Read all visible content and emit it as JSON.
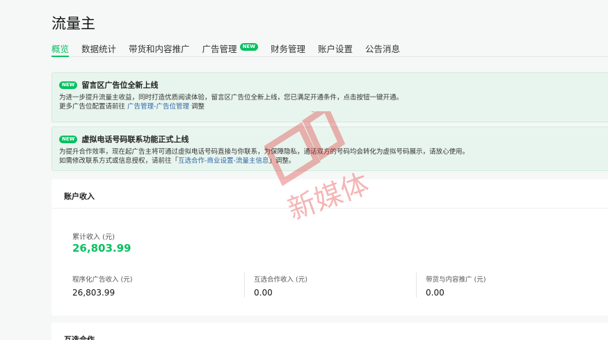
{
  "page": {
    "title": "流量主"
  },
  "tabs": [
    {
      "label": "概览",
      "active": true
    },
    {
      "label": "数据统计"
    },
    {
      "label": "带货和内容推广"
    },
    {
      "label": "广告管理",
      "badge": "NEW"
    },
    {
      "label": "财务管理"
    },
    {
      "label": "账户设置"
    },
    {
      "label": "公告消息"
    }
  ],
  "notices": [
    {
      "badge": "NEW",
      "title": "留言区广告位全新上线",
      "line1": "为进一步提升流量主收益，同时打造优质阅读体验，留言区广告位全新上线，您已满足开通条件，点击按钮一键开通。",
      "line2_prefix": "更多广告位配置请前往 ",
      "line2_link": "广告管理-广告位管理",
      "line2_suffix": " 调整"
    },
    {
      "badge": "NEW",
      "title": "虚拟电话号码联系功能正式上线",
      "line1": "为提升合作效率，现在起广告主将可通过虚拟电话号码直接与你联系，为保障隐私，通话双方的号码均会转化为虚拟号码展示，请放心使用。",
      "line2_prefix": "如需修改联系方式或信息授权，请前往「",
      "line2_link": "互选合作-商业设置-流量主信息",
      "line2_suffix": "」调整。"
    }
  ],
  "income": {
    "title": "账户收入",
    "total_label": "累计收入 (元)",
    "total_value": "26,803.99",
    "items": [
      {
        "label": "程序化广告收入 (元)",
        "value": "26,803.99"
      },
      {
        "label": "互选合作收入 (元)",
        "value": "0.00"
      },
      {
        "label": "带货与内容推广 (元)",
        "value": "0.00"
      }
    ]
  },
  "mutual": {
    "title": "互选合作"
  },
  "watermark": {
    "text": "新媒体"
  },
  "colors": {
    "accent": "#07c160",
    "link": "#2f64a8",
    "notice_bg": "#e8f5ee",
    "watermark": "#e02020"
  }
}
